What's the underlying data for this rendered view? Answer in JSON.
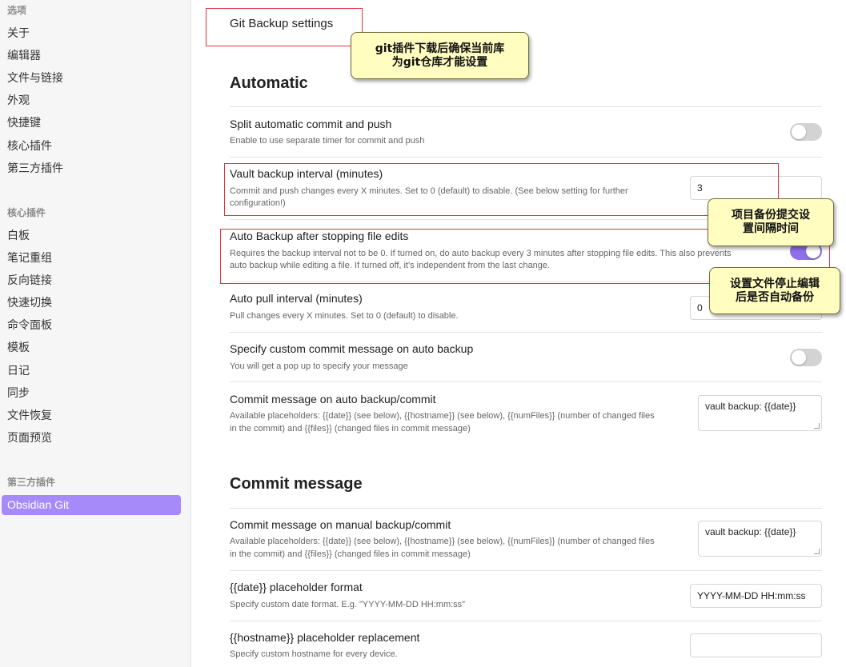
{
  "sidebar": {
    "options_heading": "选项",
    "options": [
      "关于",
      "编辑器",
      "文件与链接",
      "外观",
      "快捷键",
      "核心插件",
      "第三方插件"
    ],
    "core_heading": "核心插件",
    "core": [
      "白板",
      "笔记重组",
      "反向链接",
      "快速切换",
      "命令面板",
      "模板",
      "日记",
      "同步",
      "文件恢复",
      "页面预览"
    ],
    "third_heading": "第三方插件",
    "third": [
      "Obsidian Git"
    ]
  },
  "main": {
    "title": "Git Backup settings",
    "automatic_heading": "Automatic",
    "commit_message_heading": "Commit message",
    "settings": {
      "split": {
        "name": "Split automatic commit and push",
        "desc": "Enable to use separate timer for commit and push",
        "enabled": false
      },
      "vault_interval": {
        "name": "Vault backup interval (minutes)",
        "desc1": "Commit and push changes every X minutes. Set to 0 (default) to disable. (See below setting for further",
        "desc2": "configuration!)",
        "value": "3"
      },
      "auto_backup_stop": {
        "name": "Auto Backup after stopping file edits",
        "desc1": "Requires the backup interval not to be 0. If turned on, do auto backup every 3 minutes after stopping file edits. This also prevents",
        "desc2": "auto backup while editing a file. If turned off, it's independent from the last change.",
        "enabled": true
      },
      "pull_interval": {
        "name": "Auto pull interval (minutes)",
        "desc": "Pull changes every X minutes. Set to 0 (default) to disable.",
        "value": "0"
      },
      "custom_msg": {
        "name": "Specify custom commit message on auto backup",
        "desc": "You will get a pop up to specify your message",
        "enabled": false
      },
      "auto_commit_msg": {
        "name": "Commit message on auto backup/commit",
        "desc1": "Available placeholders: {{date}} (see below), {{hostname}} (see below), {{numFiles}} (number of changed files",
        "desc2": "in the commit) and {{files}} (changed files in commit message)",
        "value": "vault backup: {{date}}"
      },
      "manual_commit_msg": {
        "name": "Commit message on manual backup/commit",
        "desc1": "Available placeholders: {{date}} (see below), {{hostname}} (see below), {{numFiles}} (number of changed files",
        "desc2": "in the commit) and {{files}} (changed files in commit message)",
        "value": "vault backup: {{date}}"
      },
      "date_format": {
        "name": "{{date}} placeholder format",
        "desc": "Specify custom date format. E.g. \"YYYY-MM-DD HH:mm:ss\"",
        "value": "YYYY-MM-DD HH:mm:ss"
      },
      "hostname": {
        "name": "{{hostname}} placeholder replacement",
        "desc": "Specify custom hostname for every device.",
        "value": ""
      }
    }
  },
  "callouts": {
    "git_note": "git插件下载后确保当前库\n为git仓库才能设置",
    "interval_note": "项目备份提交设\n置间隔时间",
    "stop_note": "设置文件停止编辑\n后是否自动备份"
  },
  "colors": {
    "accent": "#a68af9",
    "annotation_border": "#e0333f",
    "callout_bg": "#fffdc0"
  }
}
